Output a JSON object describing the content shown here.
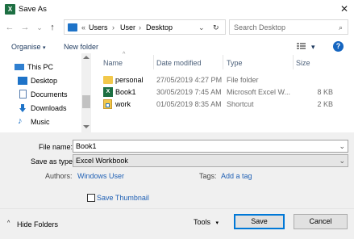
{
  "window": {
    "title": "Save As",
    "app_icon_letter": "X",
    "close_glyph": "✕"
  },
  "nav": {
    "back": "←",
    "forward": "→",
    "dropdown": "⌄",
    "up": "↑"
  },
  "address": {
    "prefix": "«",
    "crumbs": [
      "Users",
      "User",
      "Desktop"
    ],
    "sep": "›",
    "dropdown": "⌄",
    "refresh": "↻"
  },
  "search": {
    "placeholder": "Search Desktop",
    "icon": "⌕"
  },
  "toolbar": {
    "organise": "Organise",
    "new_folder": "New folder",
    "caret": "▾",
    "help": "?"
  },
  "sidebar": {
    "items": [
      {
        "label": "This PC",
        "icon": "monitor-icon"
      },
      {
        "label": "Desktop",
        "icon": "desktop-folder-icon"
      },
      {
        "label": "Documents",
        "icon": "documents-icon"
      },
      {
        "label": "Downloads",
        "icon": "downloads-icon"
      },
      {
        "label": "Music",
        "icon": "music-icon"
      }
    ]
  },
  "columns": {
    "name": "Name",
    "date": "Date modified",
    "type": "Type",
    "size": "Size",
    "sort_caret": "^"
  },
  "files": [
    {
      "name": "personal",
      "date": "27/05/2019 4:27 PM",
      "type": "File folder",
      "size": "",
      "icon": "folder-icon"
    },
    {
      "name": "Book1",
      "date": "30/05/2019 7:45 AM",
      "type": "Microsoft Excel W...",
      "size": "8 KB",
      "icon": "excel-file-icon"
    },
    {
      "name": "work",
      "date": "01/05/2019 8:35 AM",
      "type": "Shortcut",
      "size": "2 KB",
      "icon": "shortcut-icon"
    }
  ],
  "form": {
    "file_name_label": "File name:",
    "file_name_value": "Book1",
    "save_type_label": "Save as type:",
    "save_type_value": "Excel Workbook",
    "authors_label": "Authors:",
    "authors_value": "Windows User",
    "tags_label": "Tags:",
    "tags_value": "Add a tag",
    "thumbnail_label": "Save Thumbnail"
  },
  "footer": {
    "hide_folders": "Hide Folders",
    "tools": "Tools",
    "save": "Save",
    "cancel": "Cancel",
    "chevron_up": "^"
  },
  "colors": {
    "accent": "#0078d7",
    "excel_green": "#1d6f42",
    "link": "#1e5fb4",
    "folder_yellow": "#f2c84b"
  }
}
